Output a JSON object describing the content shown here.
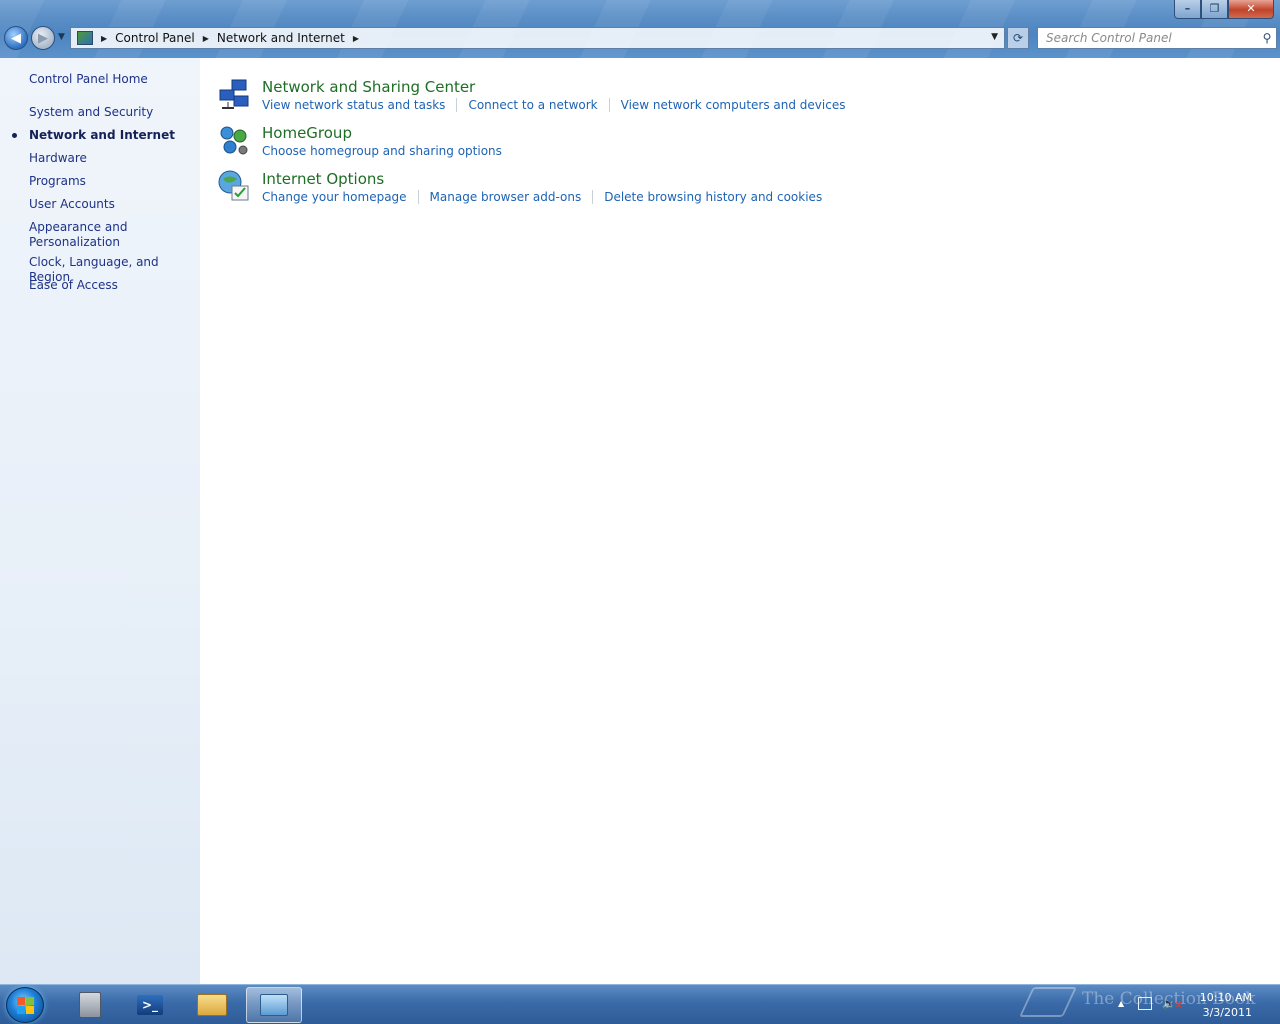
{
  "window": {
    "minimize_label": "–",
    "restore_label": "❐",
    "close_label": "✕"
  },
  "address": {
    "crumbs": [
      "Control Panel",
      "Network and Internet"
    ],
    "search_placeholder": "Search Control Panel"
  },
  "sidebar": {
    "items": [
      {
        "label": "Control Panel Home"
      },
      {
        "label": "System and Security"
      },
      {
        "label": "Network and Internet",
        "active": true
      },
      {
        "label": "Hardware"
      },
      {
        "label": "Programs"
      },
      {
        "label": "User Accounts"
      },
      {
        "label": "Appearance and Personalization"
      },
      {
        "label": "Clock, Language, and Region"
      },
      {
        "label": "Ease of Access"
      }
    ]
  },
  "categories": [
    {
      "title": "Network and Sharing Center",
      "icon": "network-sharing-icon",
      "links": [
        "View network status and tasks",
        "Connect to a network",
        "View network computers and devices"
      ]
    },
    {
      "title": "HomeGroup",
      "icon": "homegroup-icon",
      "links": [
        "Choose homegroup and sharing options"
      ]
    },
    {
      "title": "Internet Options",
      "icon": "internet-options-icon",
      "links": [
        "Change your homepage",
        "Manage browser add-ons",
        "Delete browsing history and cookies"
      ]
    }
  ],
  "taskbar": {
    "ps_glyph": ">_",
    "watermark": "The Collection Book",
    "time": "10:10 AM",
    "date": "3/3/2011"
  },
  "colors": {
    "link": "#1e63b4",
    "category_title": "#1e6e25",
    "sidebar_link": "#1e3287"
  }
}
